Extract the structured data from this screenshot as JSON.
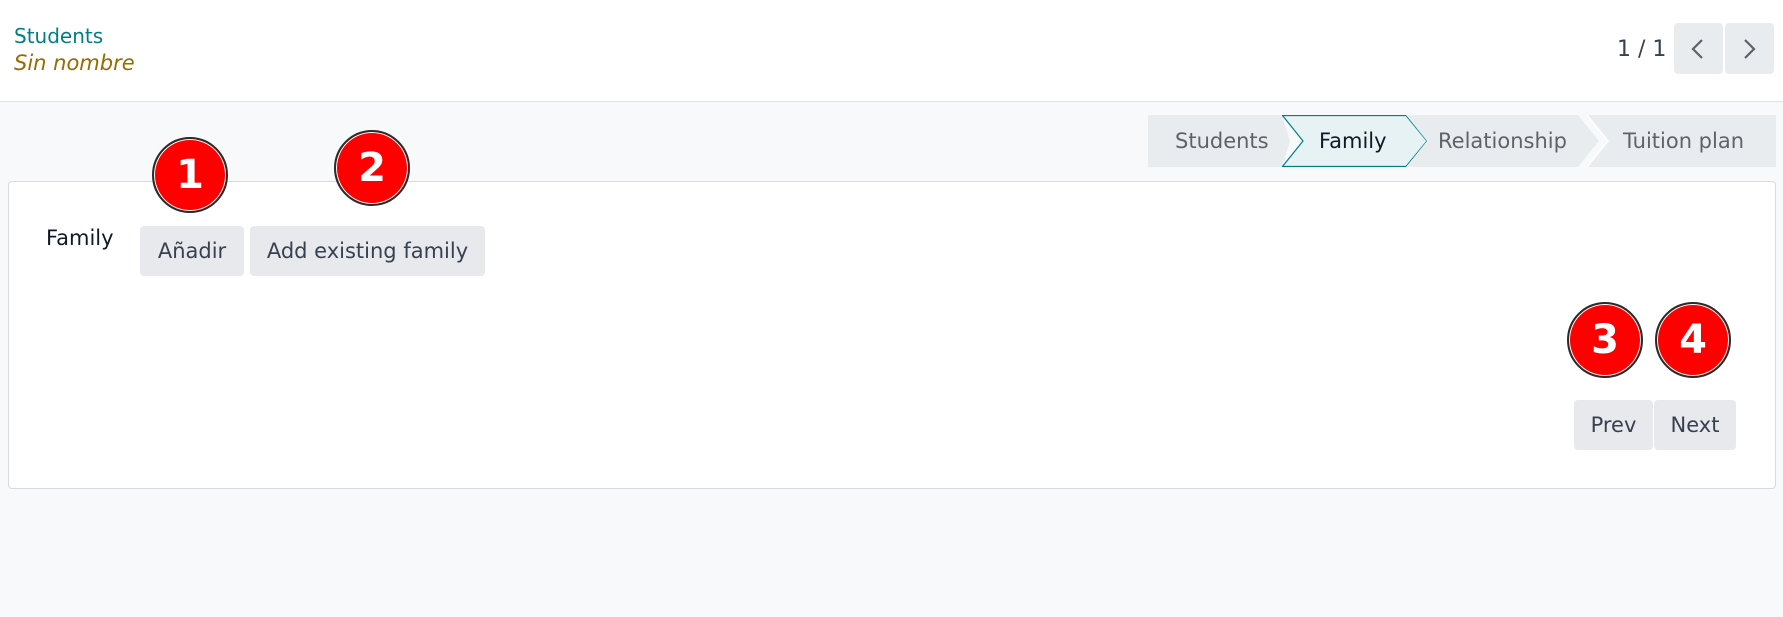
{
  "header": {
    "breadcrumb": "Students",
    "record_name": "Sin nombre",
    "pager_counter": "1 / 1"
  },
  "statusbar": {
    "steps": [
      {
        "label": "Students",
        "active": false
      },
      {
        "label": "Family",
        "active": true
      },
      {
        "label": "Relationship",
        "active": false
      },
      {
        "label": "Tuition plan",
        "active": false
      }
    ]
  },
  "form": {
    "field_label": "Family",
    "add_label": "Añadir",
    "add_existing_label": "Add existing family",
    "prev_label": "Prev",
    "next_label": "Next"
  },
  "markers": [
    "1",
    "2",
    "3",
    "4"
  ],
  "colors": {
    "accent": "#017e84",
    "record_name": "#9a6a00",
    "marker": "#ff0000",
    "button_bg": "#e7e9ed"
  },
  "icons": {
    "pager_prev": "chevron-left-icon",
    "pager_next": "chevron-right-icon"
  }
}
